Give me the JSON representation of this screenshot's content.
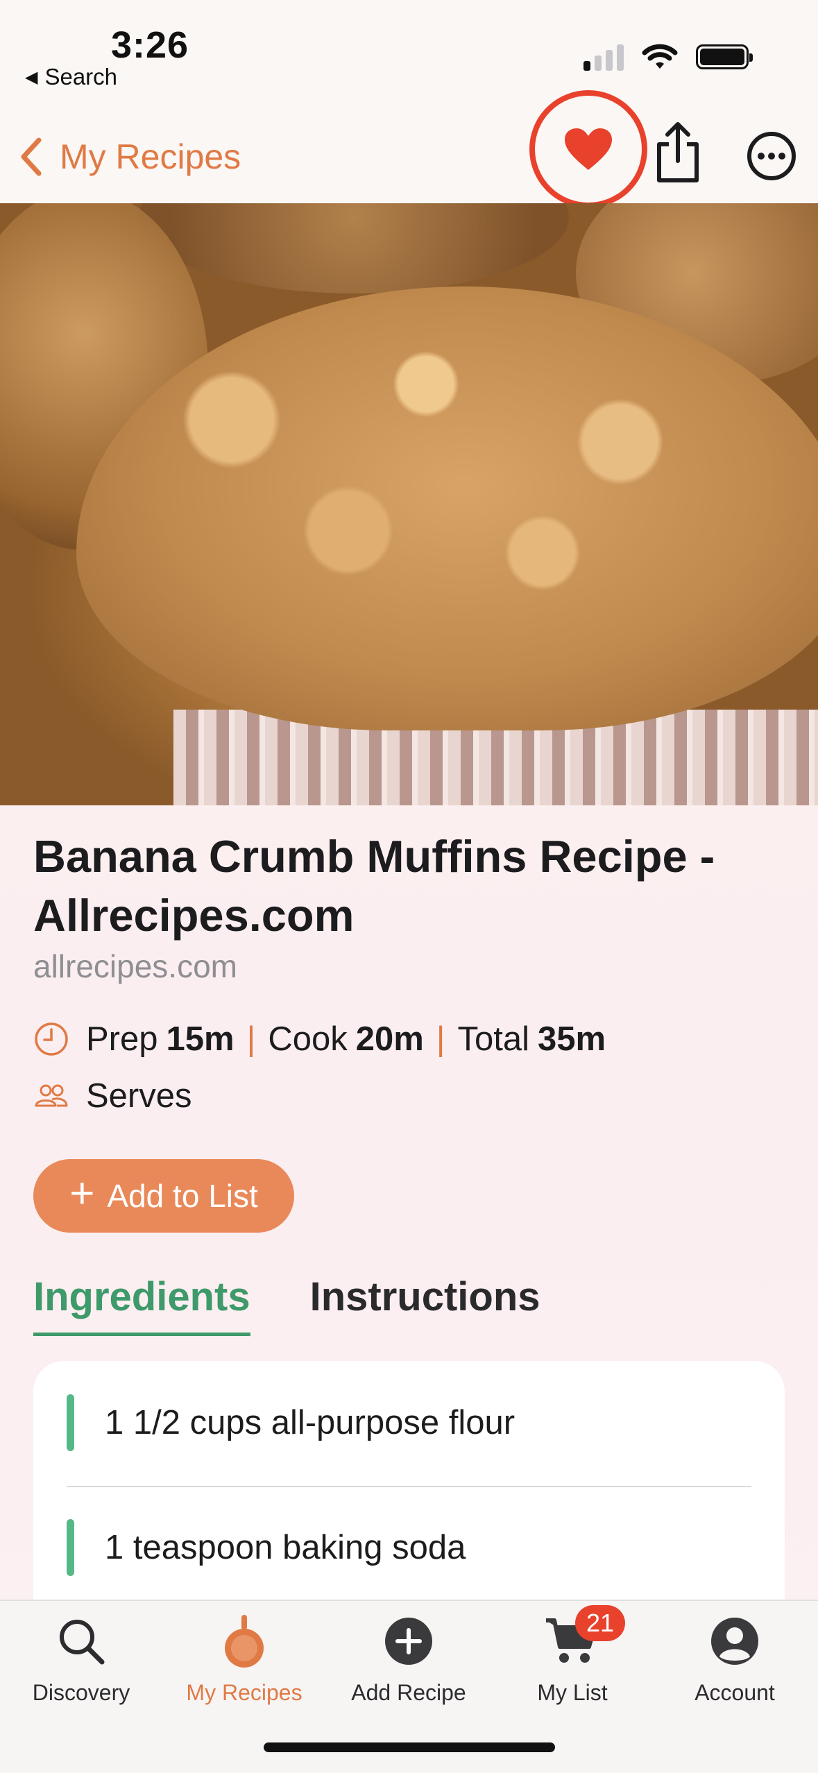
{
  "status_bar": {
    "time": "3:26",
    "back_app": "Search"
  },
  "nav": {
    "back_label": "My Recipes",
    "accent_color": "#e07a45",
    "favorite_color": "#e8412c"
  },
  "recipe": {
    "title": "Banana Crumb Muffins Recipe - Allrecipes.com",
    "source": "allrecipes.com",
    "prep_label": "Prep",
    "prep_value": "15m",
    "cook_label": "Cook",
    "cook_value": "20m",
    "total_label": "Total",
    "total_value": "35m",
    "separator": "|",
    "serves_label": "Serves"
  },
  "actions": {
    "add_to_list": "Add to List"
  },
  "tabs": [
    {
      "label": "Ingredients",
      "active": true
    },
    {
      "label": "Instructions",
      "active": false
    }
  ],
  "ingredients": [
    "1 1/2 cups all-purpose flour",
    "1 teaspoon baking soda"
  ],
  "tab_bar": {
    "items": [
      {
        "label": "Discovery",
        "icon": "search-icon"
      },
      {
        "label": "My Recipes",
        "icon": "pan-icon",
        "active": true
      },
      {
        "label": "Add Recipe",
        "icon": "plus-circle-icon"
      },
      {
        "label": "My List",
        "icon": "cart-icon",
        "badge": "21"
      },
      {
        "label": "Account",
        "icon": "person-icon"
      }
    ]
  }
}
